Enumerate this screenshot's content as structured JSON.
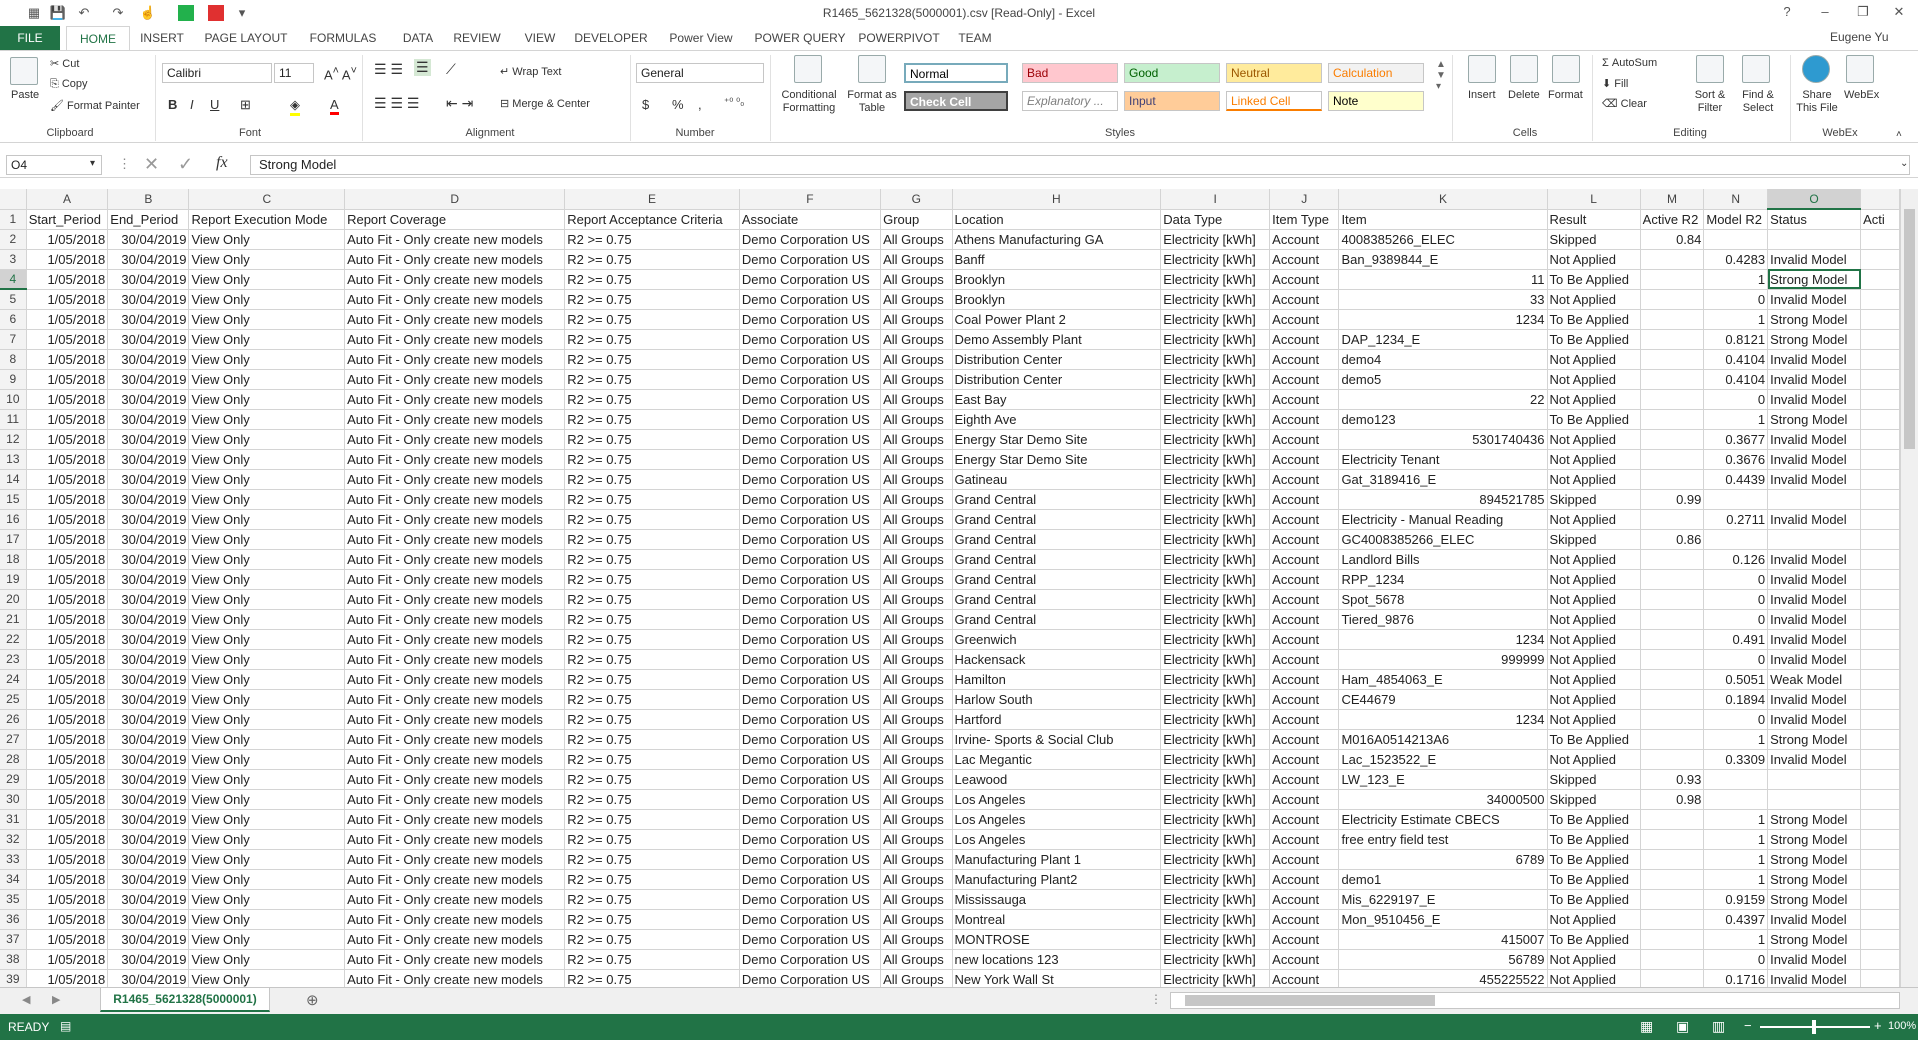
{
  "window": {
    "title": "R1465_5621328(5000001).csv  [Read-Only] - Excel",
    "user": "Eugene Yu",
    "help": "?",
    "minimize": "–",
    "restore": "❐",
    "close": "✕"
  },
  "tabs": [
    "FILE",
    "HOME",
    "INSERT",
    "PAGE LAYOUT",
    "FORMULAS",
    "DATA",
    "REVIEW",
    "VIEW",
    "DEVELOPER",
    "Power View",
    "POWER QUERY",
    "POWERPIVOT",
    "TEAM"
  ],
  "ribbon": {
    "clipboard": {
      "paste": "Paste",
      "cut": "Cut",
      "copy": "Copy",
      "format_painter": "Format Painter",
      "label": "Clipboard"
    },
    "font": {
      "name": "Calibri",
      "size": "11",
      "bold": "B",
      "italic": "I",
      "underline": "U",
      "label": "Font"
    },
    "alignment": {
      "wrap": "Wrap Text",
      "merge": "Merge & Center",
      "label": "Alignment"
    },
    "number": {
      "format": "General",
      "currency": "$",
      "percent": "%",
      "comma": ",",
      "label": "Number"
    },
    "styles": {
      "conditional": "Conditional Formatting",
      "format_table": "Format as Table",
      "cells": [
        {
          "name": "Normal",
          "bg": "#ffffff",
          "fg": "#000000"
        },
        {
          "name": "Bad",
          "bg": "#ffc7ce",
          "fg": "#9c0006"
        },
        {
          "name": "Good",
          "bg": "#c6efce",
          "fg": "#006100"
        },
        {
          "name": "Neutral",
          "bg": "#ffeb9c",
          "fg": "#9c5700"
        },
        {
          "name": "Calculation",
          "bg": "#f2f2f2",
          "fg": "#fa7d00"
        },
        {
          "name": "Check Cell",
          "bg": "#a5a5a5",
          "fg": "#ffffff"
        },
        {
          "name": "Explanatory ...",
          "bg": "#ffffff",
          "fg": "#7f7f7f"
        },
        {
          "name": "Input",
          "bg": "#ffcc99",
          "fg": "#3f3f76"
        },
        {
          "name": "Linked Cell",
          "bg": "#ffffff",
          "fg": "#fa7d00"
        },
        {
          "name": "Note",
          "bg": "#ffffcc",
          "fg": "#000000"
        }
      ],
      "label": "Styles"
    },
    "cells": {
      "insert": "Insert",
      "delete": "Delete",
      "format": "Format",
      "label": "Cells"
    },
    "editing": {
      "autosum": "AutoSum",
      "fill": "Fill",
      "clear": "Clear",
      "sort": "Sort & Filter",
      "find": "Find & Select",
      "label": "Editing"
    },
    "webex": {
      "share": "Share This File",
      "webex": "WebEx",
      "label": "WebEx"
    }
  },
  "formula_bar": {
    "name_box": "O4",
    "fx": "fx",
    "content": "Strong Model"
  },
  "columns": [
    "A",
    "B",
    "C",
    "D",
    "E",
    "F",
    "G",
    "H",
    "I",
    "J",
    "K",
    "L",
    "M",
    "N",
    "O",
    ""
  ],
  "headers": [
    "Start_Period",
    "End_Period",
    "Report Execution Mode",
    "Report Coverage",
    "Report Acceptance Criteria",
    "Associate",
    "Group",
    "Location",
    "Data Type",
    "Item Type",
    "Item",
    "Result",
    "Active R2",
    "Model R2",
    "Status",
    "Acti"
  ],
  "common": {
    "start": "1/05/2018",
    "end": "30/04/2019",
    "mode": "View Only",
    "coverage": "Auto Fit - Only create new models",
    "criteria": "R2 >= 0.75",
    "associate": "Demo Corporation US",
    "group": "All Groups",
    "datatype": "Electricity [kWh]",
    "itemtype": "Account"
  },
  "rows": [
    {
      "loc": "Athens Manufacturing GA",
      "item": "4008385266_ELEC",
      "itemnum": false,
      "result": "Skipped",
      "ar2": "0.84",
      "mr2": "",
      "status": ""
    },
    {
      "loc": "Banff",
      "item": "Ban_9389844_E",
      "itemnum": false,
      "result": "Not Applied",
      "ar2": "",
      "mr2": "0.4283",
      "status": "Invalid Model"
    },
    {
      "loc": "Brooklyn",
      "item": "11",
      "itemnum": true,
      "result": "To Be Applied",
      "ar2": "",
      "mr2": "1",
      "status": "Strong Model"
    },
    {
      "loc": "Brooklyn",
      "item": "33",
      "itemnum": true,
      "result": "Not Applied",
      "ar2": "",
      "mr2": "0",
      "status": "Invalid Model"
    },
    {
      "loc": "Coal Power Plant 2",
      "item": "1234",
      "itemnum": true,
      "result": "To Be Applied",
      "ar2": "",
      "mr2": "1",
      "status": "Strong Model"
    },
    {
      "loc": "Demo Assembly Plant",
      "item": "DAP_1234_E",
      "itemnum": false,
      "result": "To Be Applied",
      "ar2": "",
      "mr2": "0.8121",
      "status": "Strong Model"
    },
    {
      "loc": "Distribution Center",
      "item": "demo4",
      "itemnum": false,
      "result": "Not Applied",
      "ar2": "",
      "mr2": "0.4104",
      "status": "Invalid Model"
    },
    {
      "loc": "Distribution Center",
      "item": "demo5",
      "itemnum": false,
      "result": "Not Applied",
      "ar2": "",
      "mr2": "0.4104",
      "status": "Invalid Model"
    },
    {
      "loc": "East Bay",
      "item": "22",
      "itemnum": true,
      "result": "Not Applied",
      "ar2": "",
      "mr2": "0",
      "status": "Invalid Model"
    },
    {
      "loc": "Eighth Ave",
      "item": "demo123",
      "itemnum": false,
      "result": "To Be Applied",
      "ar2": "",
      "mr2": "1",
      "status": "Strong Model"
    },
    {
      "loc": "Energy Star Demo Site",
      "item": "5301740436",
      "itemnum": true,
      "result": "Not Applied",
      "ar2": "",
      "mr2": "0.3677",
      "status": "Invalid Model"
    },
    {
      "loc": "Energy Star Demo Site",
      "item": "Electricity Tenant",
      "itemnum": false,
      "result": "Not Applied",
      "ar2": "",
      "mr2": "0.3676",
      "status": "Invalid Model"
    },
    {
      "loc": "Gatineau",
      "item": "Gat_3189416_E",
      "itemnum": false,
      "result": "Not Applied",
      "ar2": "",
      "mr2": "0.4439",
      "status": "Invalid Model"
    },
    {
      "loc": "Grand Central",
      "item": "894521785",
      "itemnum": true,
      "result": "Skipped",
      "ar2": "0.99",
      "mr2": "",
      "status": ""
    },
    {
      "loc": "Grand Central",
      "item": "Electricity - Manual Reading",
      "itemnum": false,
      "result": "Not Applied",
      "ar2": "",
      "mr2": "0.2711",
      "status": "Invalid Model"
    },
    {
      "loc": "Grand Central",
      "item": "GC4008385266_ELEC",
      "itemnum": false,
      "result": "Skipped",
      "ar2": "0.86",
      "mr2": "",
      "status": ""
    },
    {
      "loc": "Grand Central",
      "item": "Landlord Bills",
      "itemnum": false,
      "result": "Not Applied",
      "ar2": "",
      "mr2": "0.126",
      "status": "Invalid Model"
    },
    {
      "loc": "Grand Central",
      "item": "RPP_1234",
      "itemnum": false,
      "result": "Not Applied",
      "ar2": "",
      "mr2": "0",
      "status": "Invalid Model"
    },
    {
      "loc": "Grand Central",
      "item": "Spot_5678",
      "itemnum": false,
      "result": "Not Applied",
      "ar2": "",
      "mr2": "0",
      "status": "Invalid Model"
    },
    {
      "loc": "Grand Central",
      "item": "Tiered_9876",
      "itemnum": false,
      "result": "Not Applied",
      "ar2": "",
      "mr2": "0",
      "status": "Invalid Model"
    },
    {
      "loc": "Greenwich",
      "item": "1234",
      "itemnum": true,
      "result": "Not Applied",
      "ar2": "",
      "mr2": "0.491",
      "status": "Invalid Model"
    },
    {
      "loc": "Hackensack",
      "item": "999999",
      "itemnum": true,
      "result": "Not Applied",
      "ar2": "",
      "mr2": "0",
      "status": "Invalid Model"
    },
    {
      "loc": "Hamilton",
      "item": "Ham_4854063_E",
      "itemnum": false,
      "result": "Not Applied",
      "ar2": "",
      "mr2": "0.5051",
      "status": "Weak Model"
    },
    {
      "loc": "Harlow South",
      "item": "CE44679",
      "itemnum": false,
      "result": "Not Applied",
      "ar2": "",
      "mr2": "0.1894",
      "status": "Invalid Model"
    },
    {
      "loc": "Hartford",
      "item": "1234",
      "itemnum": true,
      "result": "Not Applied",
      "ar2": "",
      "mr2": "0",
      "status": "Invalid Model"
    },
    {
      "loc": "Irvine- Sports & Social Club",
      "item": "M016A0514213A6",
      "itemnum": false,
      "result": "To Be Applied",
      "ar2": "",
      "mr2": "1",
      "status": "Strong Model"
    },
    {
      "loc": "Lac Megantic",
      "item": "Lac_1523522_E",
      "itemnum": false,
      "result": "Not Applied",
      "ar2": "",
      "mr2": "0.3309",
      "status": "Invalid Model"
    },
    {
      "loc": "Leawood",
      "item": "LW_123_E",
      "itemnum": false,
      "result": "Skipped",
      "ar2": "0.93",
      "mr2": "",
      "status": ""
    },
    {
      "loc": "Los Angeles",
      "item": "34000500",
      "itemnum": true,
      "result": "Skipped",
      "ar2": "0.98",
      "mr2": "",
      "status": ""
    },
    {
      "loc": "Los Angeles",
      "item": "Electricity Estimate CBECS",
      "itemnum": false,
      "result": "To Be Applied",
      "ar2": "",
      "mr2": "1",
      "status": "Strong Model"
    },
    {
      "loc": "Los Angeles",
      "item": "free entry field test",
      "itemnum": false,
      "result": "To Be Applied",
      "ar2": "",
      "mr2": "1",
      "status": "Strong Model"
    },
    {
      "loc": "Manufacturing Plant 1",
      "item": "6789",
      "itemnum": true,
      "result": "To Be Applied",
      "ar2": "",
      "mr2": "1",
      "status": "Strong Model"
    },
    {
      "loc": "Manufacturing Plant2",
      "item": "demo1",
      "itemnum": false,
      "result": "To Be Applied",
      "ar2": "",
      "mr2": "1",
      "status": "Strong Model"
    },
    {
      "loc": "Mississauga",
      "item": "Mis_6229197_E",
      "itemnum": false,
      "result": "To Be Applied",
      "ar2": "",
      "mr2": "0.9159",
      "status": "Strong Model"
    },
    {
      "loc": "Montreal",
      "item": "Mon_9510456_E",
      "itemnum": false,
      "result": "Not Applied",
      "ar2": "",
      "mr2": "0.4397",
      "status": "Invalid Model"
    },
    {
      "loc": "MONTROSE",
      "item": "415007",
      "itemnum": true,
      "result": "To Be Applied",
      "ar2": "",
      "mr2": "1",
      "status": "Strong Model"
    },
    {
      "loc": "new locations 123",
      "item": "56789",
      "itemnum": true,
      "result": "Not Applied",
      "ar2": "",
      "mr2": "0",
      "status": "Invalid Model"
    },
    {
      "loc": "New York Wall St",
      "item": "455225522",
      "itemnum": true,
      "result": "Not Applied",
      "ar2": "",
      "mr2": "0.1716",
      "status": "Invalid Model"
    }
  ],
  "sheet_tab": "R1465_5621328(5000001)",
  "status": {
    "mode": "READY",
    "zoom": "100%"
  }
}
